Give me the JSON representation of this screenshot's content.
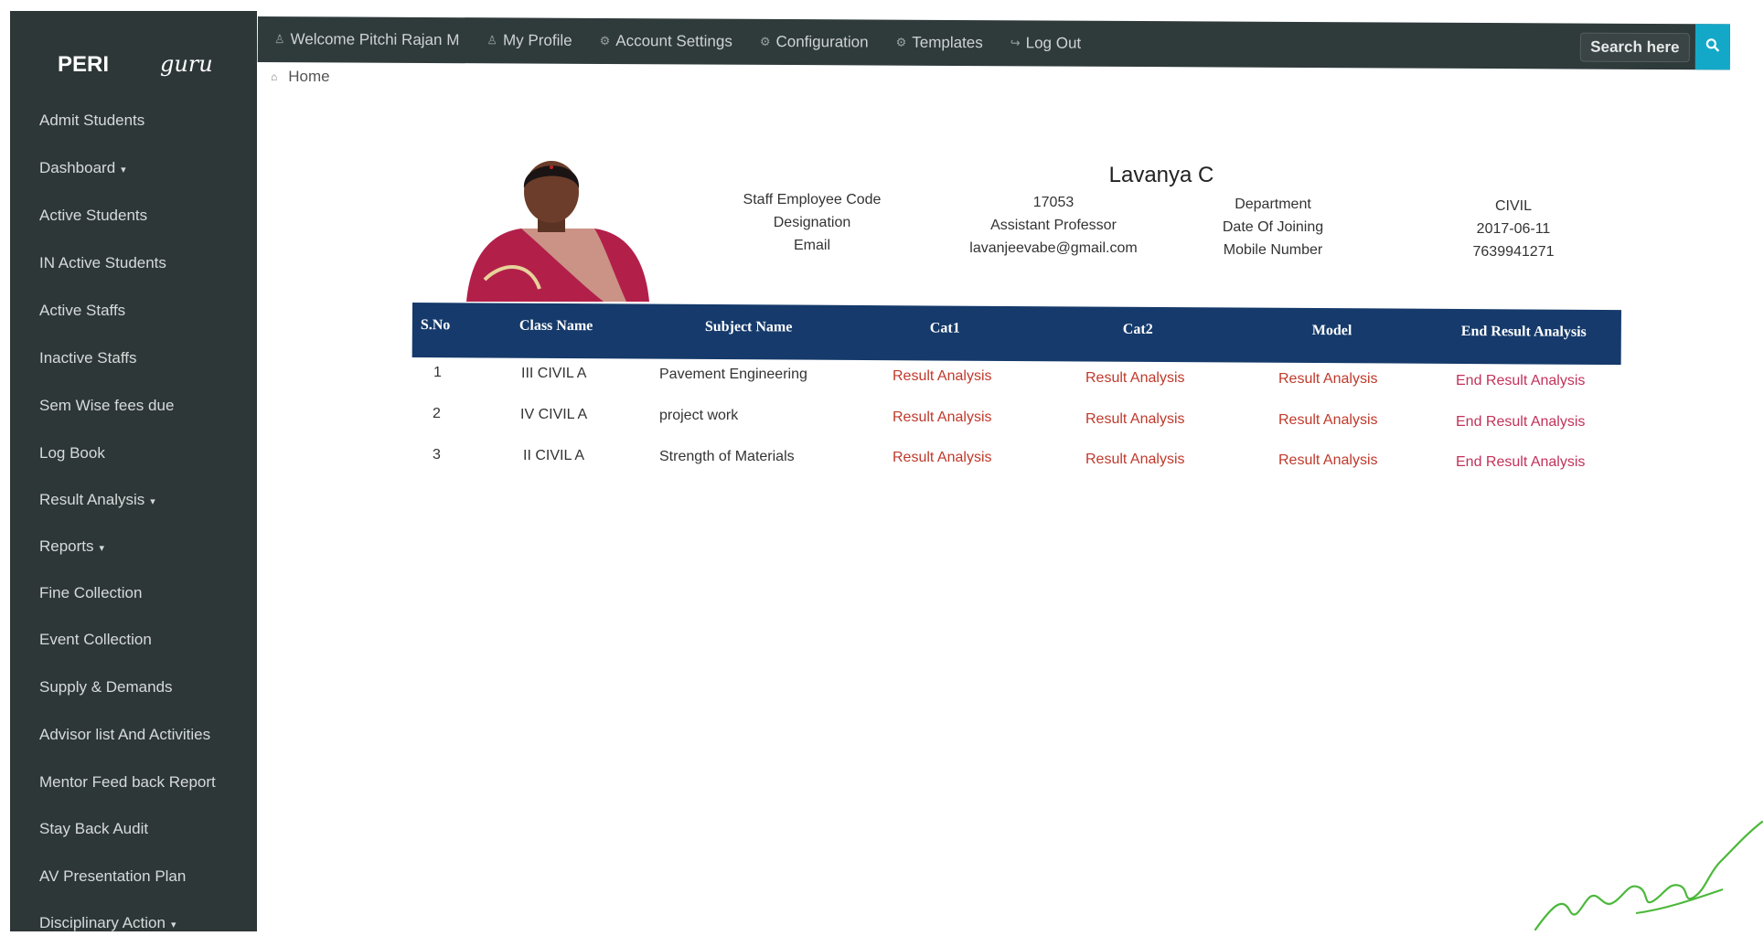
{
  "brand": {
    "part1": "PERI",
    "part2": "guru"
  },
  "topnav": [
    {
      "label": "Welcome Pitchi Rajan M",
      "icon": "user-icon"
    },
    {
      "label": "My Profile",
      "icon": "user-icon"
    },
    {
      "label": "Account Settings",
      "icon": "gear-icon"
    },
    {
      "label": "Configuration",
      "icon": "gear-icon"
    },
    {
      "label": "Templates",
      "icon": "gear-icon"
    },
    {
      "label": "Log Out",
      "icon": "logout-icon"
    }
  ],
  "search": {
    "placeholder": "Search here"
  },
  "sidebar": {
    "items": [
      {
        "label": "Admit Students"
      },
      {
        "label": "Dashboard",
        "dropdown": true
      },
      {
        "label": "Active Students"
      },
      {
        "label": "IN Active Students"
      },
      {
        "label": "Active Staffs"
      },
      {
        "label": "Inactive Staffs"
      },
      {
        "label": "Sem Wise fees due"
      },
      {
        "label": "Log Book"
      },
      {
        "label": "Result Analysis",
        "dropdown": true
      },
      {
        "label": "Reports",
        "dropdown": true
      },
      {
        "label": "Fine Collection"
      },
      {
        "label": "Event Collection"
      },
      {
        "label": "Supply & Demands"
      },
      {
        "label": "Advisor list And Activities"
      },
      {
        "label": "Mentor Feed back Report"
      },
      {
        "label": "Stay Back Audit"
      },
      {
        "label": "AV Presentation Plan"
      },
      {
        "label": "Disciplinary Action",
        "dropdown": true
      }
    ]
  },
  "breadcrumb": {
    "home": "Home"
  },
  "profile": {
    "name": "Lavanya C",
    "labels_left": [
      "Staff Employee Code",
      "Designation",
      "Email"
    ],
    "values_left": [
      "17053",
      "Assistant Professor",
      "lavanjeevabe@gmail.com"
    ],
    "labels_right": [
      "Department",
      "Date Of Joining",
      "Mobile Number"
    ],
    "values_right": [
      "CIVIL",
      "2017-06-11",
      "7639941271"
    ]
  },
  "table": {
    "headers": [
      "S.No",
      "Class Name",
      "Subject Name",
      "Cat1",
      "Cat2",
      "Model",
      "End Result Analysis"
    ],
    "rows": [
      {
        "sno": "1",
        "class": "III CIVIL A",
        "subject": "Pavement Engineering",
        "cat1": "Result Analysis",
        "cat2": "Result Analysis",
        "model": "Result Analysis",
        "end": "End Result Analysis"
      },
      {
        "sno": "2",
        "class": "IV CIVIL A",
        "subject": "project work",
        "cat1": "Result Analysis",
        "cat2": "Result Analysis",
        "model": "Result Analysis",
        "end": "End Result Analysis"
      },
      {
        "sno": "3",
        "class": "II CIVIL A",
        "subject": "Strength of Materials",
        "cat1": "Result Analysis",
        "cat2": "Result Analysis",
        "model": "Result Analysis",
        "end": "End Result Analysis"
      }
    ]
  },
  "colors": {
    "sidebar": "#2e3738",
    "topbar": "#2f3a3b",
    "table_header": "#153a6b",
    "link": "#c0392b",
    "search_button": "#14a8c8"
  }
}
